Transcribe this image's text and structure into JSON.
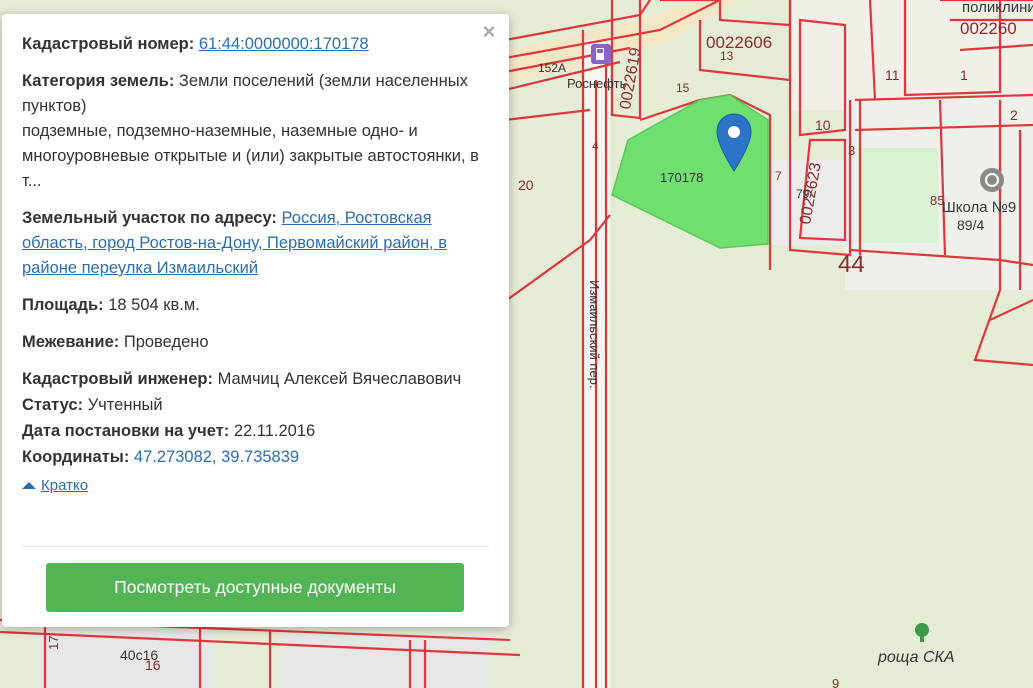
{
  "popup": {
    "close_symbol": "×",
    "cadastral_number": {
      "label": "Кадастровый номер:",
      "value": "61:44:0000000:170178"
    },
    "land_category": {
      "label": "Категория земель:",
      "value": "Земли поселений (земли населенных пунктов)",
      "extra": "подземные, подземно-наземные, наземные одно- и многоуровневые открытые и (или) закрытые автостоянки, в т..."
    },
    "address": {
      "label": "Земельный участок по адресу:",
      "value": "Россия, Ростовская область, город Ростов-на-Дону, Первомайский район, в районе переулка Измаильский"
    },
    "area": {
      "label": "Площадь:",
      "value": "18 504 кв.м."
    },
    "survey": {
      "label": "Межевание:",
      "value": "Проведено"
    },
    "engineer": {
      "label": "Кадастровый инженер:",
      "value": "Мамчиц Алексей Вячеславович"
    },
    "status": {
      "label": "Статус:",
      "value": "Учтенный"
    },
    "registration_date": {
      "label": "Дата постановки на учет:",
      "value": "22.11.2016"
    },
    "coordinates": {
      "label": "Координаты:",
      "value": "47.273082, 39.735839"
    },
    "collapse_label": "Кратко",
    "docs_button": "Посмотреть доступные документы"
  },
  "map": {
    "labels": {
      "parcel_id": "170178",
      "rosneft": "Роснефть",
      "n152a": "152А",
      "n20": "20",
      "n15": "15",
      "n13": "13",
      "n4": "4",
      "n11": "11",
      "n10": "10",
      "n7": "7",
      "n1": "1",
      "n2": "2",
      "n3": "3",
      "n9": "9",
      "n79": "79/",
      "n85": "85",
      "n89_4": "89/4",
      "n44": "44",
      "n17": "17",
      "n40s16": "40с16",
      "n16": "16",
      "school": "Школа №9",
      "polyclinic": "поликлини",
      "street": "Измаильский пер.",
      "grove": "роща СКА",
      "q0022606": "0022606",
      "q002260": "002260",
      "q0022619": "0022619",
      "q0022623": "0022623"
    },
    "colors": {
      "background": "#e4ecd6",
      "parcel_fill": "#6fe06f",
      "boundary": "#e0353b",
      "pin": "#2b74c8",
      "school_field": "#d9f0d2"
    },
    "icons": {
      "pin": "map-pin-icon",
      "fuel": "fuel-station-icon",
      "tree": "tree-icon",
      "school": "school-icon"
    }
  }
}
